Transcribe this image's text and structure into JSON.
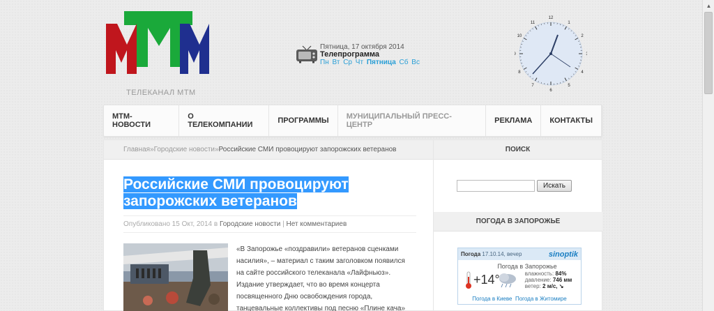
{
  "header": {
    "logo_caption": "ТЕЛЕКАНАЛ МТМ",
    "tv": {
      "date": "Пятница, 17 октября 2014",
      "title": "Телепрограмма",
      "days": [
        "Пн",
        "Вт",
        "Ср",
        "Чт",
        "Пятница",
        "Сб",
        "Вс"
      ],
      "active_day": "Пятница"
    },
    "clock_numbers": [
      "12",
      "1",
      "2",
      "3",
      "4",
      "5",
      "6",
      "7",
      "8",
      "9",
      "10",
      "11"
    ]
  },
  "nav": {
    "items": [
      {
        "label": "МТМ-НОВОСТИ"
      },
      {
        "label": "О ТЕЛЕКОМПАНИИ"
      },
      {
        "label": "ПРОГРАММЫ"
      },
      {
        "label": "МУНИЦИПАЛЬНЫЙ ПРЕСС-ЦЕНТР"
      },
      {
        "label": "РЕКЛАМА"
      },
      {
        "label": "КОНТАКТЫ"
      }
    ]
  },
  "breadcrumb": {
    "home": "Главная",
    "sep": " » ",
    "section": "Городские новости",
    "current": "Российские СМИ провоцируют запорожских ветеранов"
  },
  "article": {
    "title": "Российские СМИ провоцируют запорожских ветеранов",
    "meta_prefix": "Опубликовано 15 Окт, 2014 в ",
    "meta_category": "Городские новости",
    "meta_sep": " | ",
    "meta_comments": "Нет комментариев",
    "text": "«В Запорожье «поздравили» ветеранов сценками насилия», – материал с таким заголовком появился на сайте российского телеканала «Лайфньюз». Издание утверждает, что во время концерта посвященного Дню освобождения города, танцевальные коллективы под песню «Плине кача» показали номер об изнасиловании"
  },
  "sidebar": {
    "search_title": "ПОИСК",
    "search_button": "Искать",
    "search_value": "",
    "weather_title": "ПОГОДА В ЗАПОРОЖЬЕ",
    "weather": {
      "label": "Погода",
      "when": "17.10.14, вечер",
      "brand": "sinoptik",
      "city": "Погода в Запорожье",
      "temp": "+14°",
      "humidity_label": "влажность:",
      "humidity": "84%",
      "pressure_label": "давление:",
      "pressure": "746 мм",
      "wind_label": "ветер:",
      "wind": "2 м/с, ↘",
      "link1": "Погода в Киеве",
      "link2": "Погода в Житомире"
    }
  }
}
